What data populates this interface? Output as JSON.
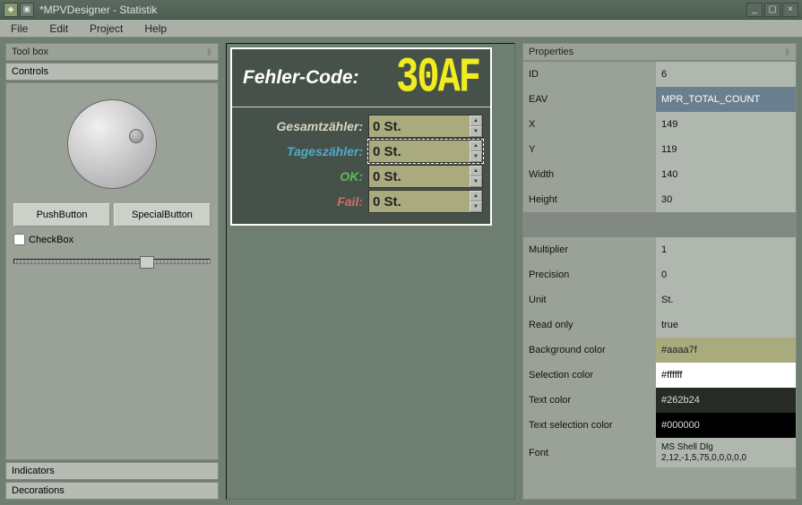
{
  "titlebar": {
    "text": "*MPVDesigner - Statistik"
  },
  "menu": {
    "file": "File",
    "edit": "Edit",
    "project": "Project",
    "help": "Help"
  },
  "toolbox": {
    "title": "Tool box",
    "controls_label": "Controls",
    "push_button": "PushButton",
    "special_button": "SpecialButton",
    "checkbox": "CheckBox",
    "indicators_label": "Indicators",
    "decorations_label": "Decorations"
  },
  "designer": {
    "fehler_label": "Fehler-Code:",
    "fehler_value": "30AF",
    "rows": {
      "gesamt": {
        "label": "Gesamtzähler:",
        "value": "0 St."
      },
      "tages": {
        "label": "Tageszähler:",
        "value": "0 St."
      },
      "ok": {
        "label": "OK:",
        "value": "0 St."
      },
      "fail": {
        "label": "Fail:",
        "value": "0 St."
      }
    }
  },
  "properties": {
    "title": "Properties",
    "rows": {
      "id": {
        "label": "ID",
        "value": "6"
      },
      "eav": {
        "label": "EAV",
        "value": "MPR_TOTAL_COUNT"
      },
      "x": {
        "label": "X",
        "value": "149"
      },
      "y": {
        "label": "Y",
        "value": "119"
      },
      "width": {
        "label": "Width",
        "value": "140"
      },
      "height": {
        "label": "Height",
        "value": "30"
      },
      "multiplier": {
        "label": "Multiplier",
        "value": "1"
      },
      "precision": {
        "label": "Precision",
        "value": "0"
      },
      "unit": {
        "label": "Unit",
        "value": "St."
      },
      "readonly": {
        "label": "Read only",
        "value": "true"
      },
      "bgcolor": {
        "label": "Background color",
        "value": "#aaaa7f"
      },
      "selcolor": {
        "label": "Selection color",
        "value": "#ffffff"
      },
      "textcolor": {
        "label": "Text color",
        "value": "#262b24"
      },
      "tselcolor": {
        "label": "Text selection color",
        "value": "#000000"
      },
      "font": {
        "label": "Font",
        "value": "MS Shell Dlg 2,12,-1,5,75,0,0,0,0,0"
      }
    }
  }
}
